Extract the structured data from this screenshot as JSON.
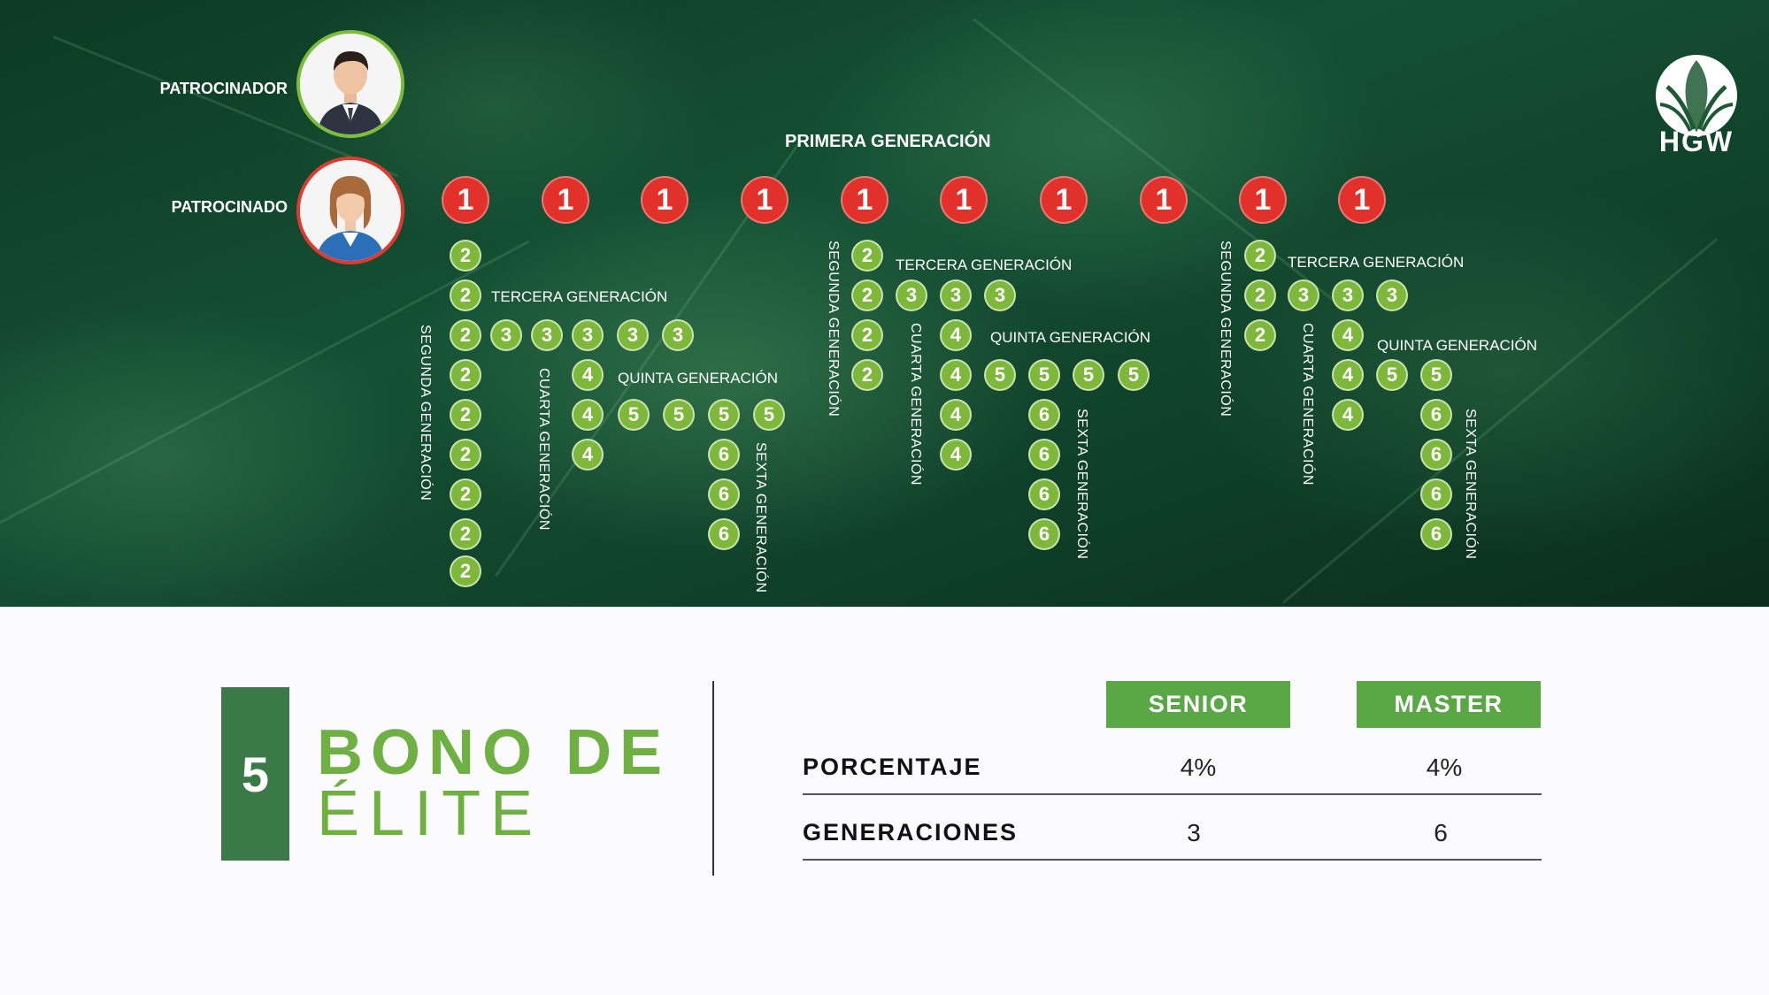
{
  "people": {
    "sponsor_label": "PATROCINADOR",
    "sponsored_label": "PATROCINADO"
  },
  "brand": {
    "logo_text": "HGW"
  },
  "tree": {
    "first_gen_title": "PRIMERA GENERACIÓN",
    "first_gen_value": "1",
    "labels": {
      "segunda": "SEGUNDA GENERACIÓN",
      "tercera": "TERCERA GENERACIÓN",
      "cuarta": "CUARTA GENERACIÓN",
      "quinta": "QUINTA GENERACIÓN",
      "sexta": "SEXTA GENERACIÓN"
    }
  },
  "bonus": {
    "number": "5",
    "title_line1": "BONO DE",
    "title_line2": "ÉLITE"
  },
  "table": {
    "columns": [
      "SENIOR",
      "MASTER"
    ],
    "rows": [
      {
        "label": "PORCENTAJE",
        "values": [
          "4%",
          "4%"
        ]
      },
      {
        "label": "GENERACIONES",
        "values": [
          "3",
          "6"
        ]
      }
    ]
  },
  "colors": {
    "red": "#e2312a",
    "green_circle": "#7db83a",
    "brand_green": "#6fb043",
    "dark_green": "#3b7a48"
  }
}
